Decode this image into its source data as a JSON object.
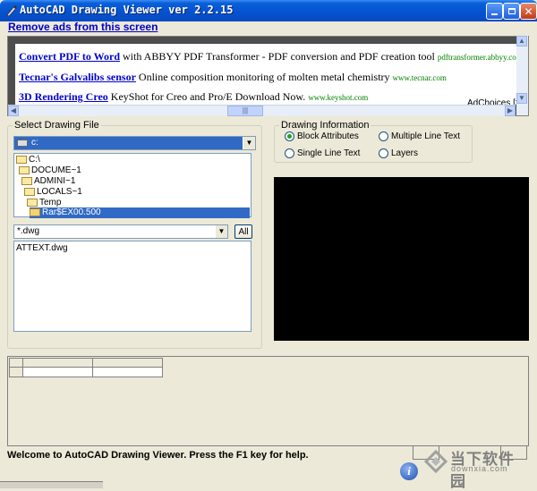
{
  "window": {
    "title": "AutoCAD Drawing Viewer ver 2.2.15"
  },
  "ads": {
    "remove_label": "Remove ads from this screen",
    "items": [
      {
        "link": "Convert PDF to Word",
        "desc": "with ABBYY PDF Transformer - PDF conversion and PDF creation tool",
        "url": "pdftransformer.abbyy.com"
      },
      {
        "link": "Tecnar's Galvalibs sensor",
        "desc": "Online composition monitoring of molten metal chemistry",
        "url": "www.tecnar.com"
      },
      {
        "link": "3D Rendering Creo",
        "desc": "KeyShot for Creo and Pro/E Download Now.",
        "url": "www.keyshot.com"
      }
    ],
    "adchoices": "AdChoices",
    "adchoices_suffix": "[>"
  },
  "select_file": {
    "legend": "Select Drawing File",
    "drive": "c:",
    "dirs": [
      "C:\\",
      "DOCUME~1",
      "ADMINI~1",
      "LOCALS~1",
      "Temp",
      "Rar$EX00.500"
    ],
    "mask": "*.dwg",
    "all_label": "All",
    "files": [
      "ATTEXT.dwg"
    ]
  },
  "drawing_info": {
    "legend": "Drawing Information",
    "options": [
      "Block Attributes",
      "Multiple Line Text",
      "Single Line Text",
      "Layers"
    ],
    "selected": "Block Attributes"
  },
  "status": {
    "text": "Welcome to AutoCAD Drawing Viewer. Press the F1 key for help.",
    "info_glyph": "i"
  },
  "watermark": {
    "big": "当下软件园",
    "small": "downxia.com"
  }
}
